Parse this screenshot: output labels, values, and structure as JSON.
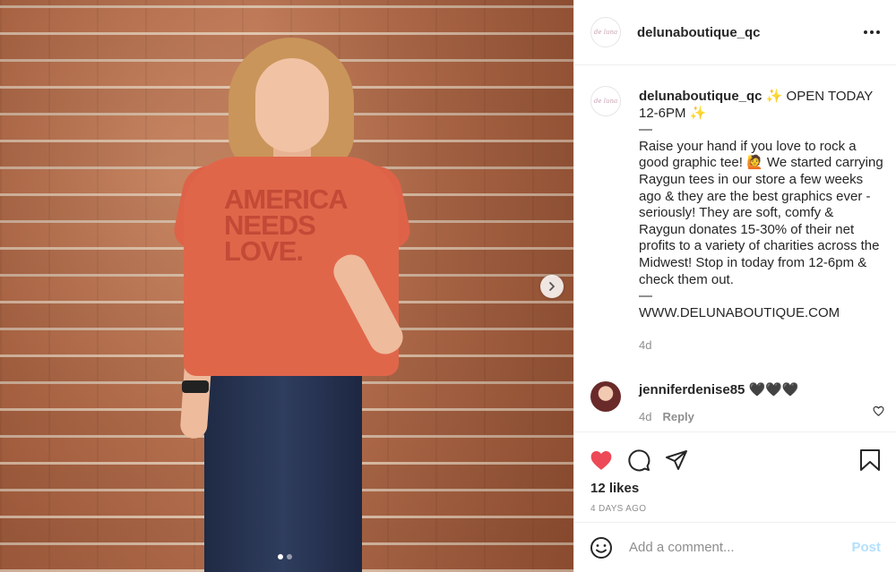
{
  "post": {
    "username": "delunaboutique_qc",
    "avatar_text": "de luna",
    "shirt_print": "AMERICA NEEDS LOVE.",
    "caption_text": "✨ OPEN TODAY 12-6PM ✨\n—\nRaise your hand if you love to rock a good graphic tee! 🙋 We started carrying Raygun tees in our store a few weeks ago & they are the best graphics ever - seriously! They are soft, comfy & Raygun donates 15-30% of their net profits to a variety of charities across the Midwest! Stop in today from 12-6pm & check them out.\n—\nWWW.DELUNABOUTIQUE.COM",
    "caption_time": "4d",
    "likes": "12 likes",
    "posted_ago": "4 DAYS AGO"
  },
  "carousel": {
    "slide_count": 2,
    "active_index": 0,
    "next_icon": "chevron-right-icon"
  },
  "comments": [
    {
      "username": "jenniferdenise85",
      "text": "🖤🖤🖤",
      "time": "4d",
      "reply_label": "Reply"
    }
  ],
  "comment_box": {
    "placeholder": "Add a comment...",
    "post_label": "Post"
  },
  "icons": {
    "more": "more-options-icon",
    "like": "heart-filled-icon",
    "comment": "comment-bubble-icon",
    "share": "paper-plane-icon",
    "save": "bookmark-icon",
    "emoji": "emoji-smile-icon",
    "comment_like": "heart-outline-icon"
  },
  "colors": {
    "like_red": "#ed4956",
    "post_disabled_blue": "#b2dffc",
    "muted_text": "#8e8e8e"
  }
}
